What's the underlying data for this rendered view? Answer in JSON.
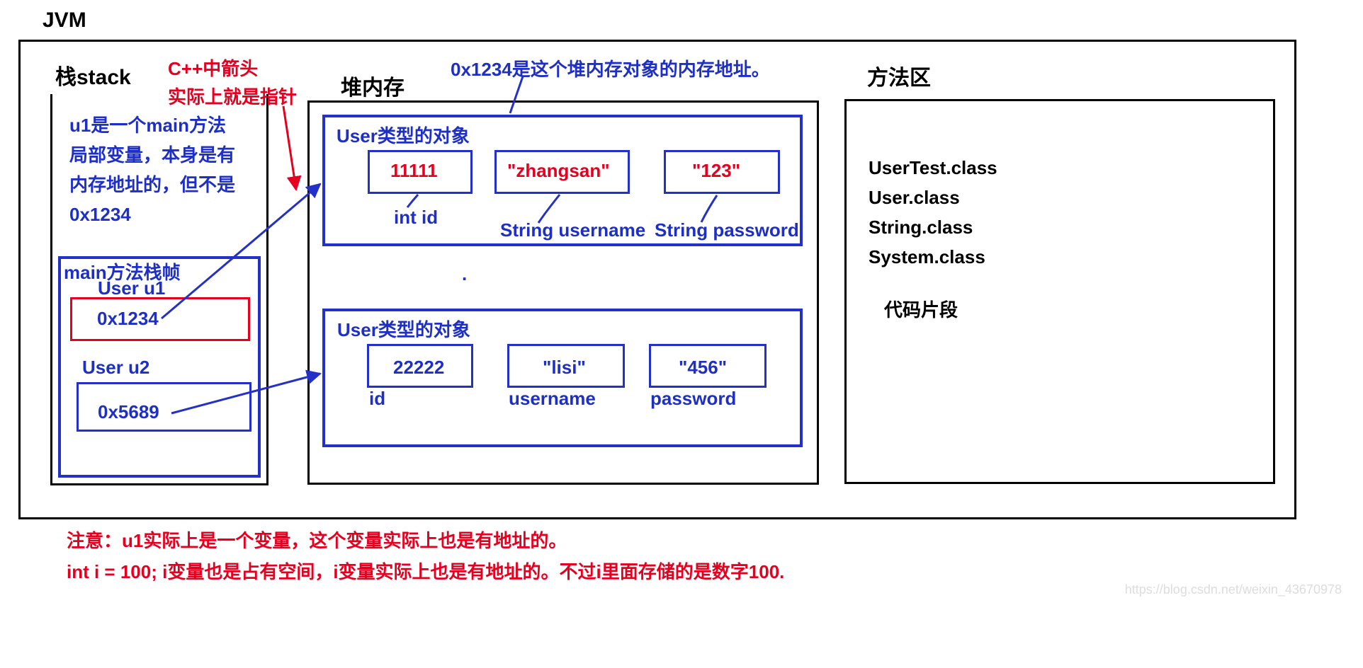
{
  "title": "JVM",
  "stack": {
    "title": "栈stack",
    "annotation": "u1是一个main方法\n局部变量，本身是有\n内存地址的，但不是\n0x1234",
    "frame_label": "main方法栈帧",
    "u1_label": "User u1",
    "u1_value": "0x1234",
    "u2_label": "User u2",
    "u2_value": "0x5689"
  },
  "cpp_note": "C++中箭头\n实际上就是指针",
  "heap": {
    "title": "堆内存",
    "addr_note": "0x1234是这个堆内存对象的内存地址。",
    "obj1": {
      "title": "User类型的对象",
      "id_val": "11111",
      "id_lab": "int id",
      "un_val": "\"zhangsan\"",
      "un_lab": "String username",
      "pw_val": "\"123\"",
      "pw_lab": "String password"
    },
    "dot": ".",
    "obj2": {
      "title": "User类型的对象",
      "id_val": "22222",
      "id_lab": "id",
      "un_val": "\"lisi\"",
      "un_lab": "username",
      "pw_val": "\"456\"",
      "pw_lab": "password"
    }
  },
  "method_area": {
    "title": "方法区",
    "classes": "UserTest.class\nUser.class\nString.class\nSystem.class",
    "code_fragment": "代码片段"
  },
  "footer": {
    "note1": "注意：u1实际上是一个变量，这个变量实际上也是有地址的。",
    "note2": "int i = 100; i变量也是占有空间，i变量实际上也是有地址的。不过i里面存储的是数字100."
  },
  "watermark": "https://blog.csdn.net/weixin_43670978"
}
